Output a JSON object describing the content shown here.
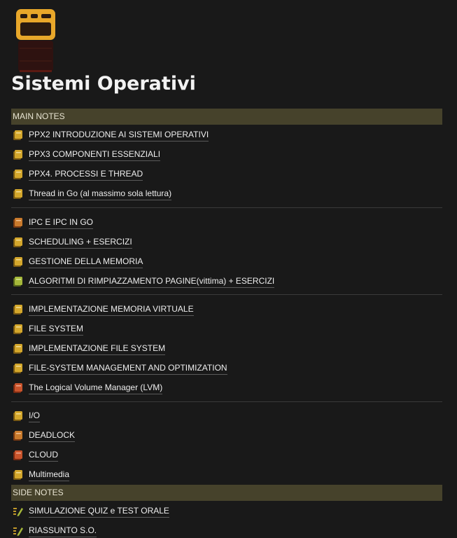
{
  "page": {
    "title": "Sistemi Operativi",
    "icon": "oven-icon"
  },
  "main_notes": {
    "header": "MAIN NOTES",
    "groups": [
      [
        {
          "label": "PPX2 INTRODUZIONE AI SISTEMI OPERATIVI",
          "icon": "notebook-icon",
          "color": "#d4a72c"
        },
        {
          "label": "PPX3 COMPONENTI ESSENZIALI",
          "icon": "notebook-icon",
          "color": "#d4a72c"
        },
        {
          "label": "PPX4. PROCESSI E THREAD",
          "icon": "notebook-icon",
          "color": "#d4a72c"
        },
        {
          "label": "Thread in Go (al massimo sola lettura)",
          "icon": "notebook-icon",
          "color": "#d4a72c"
        }
      ],
      [
        {
          "label": "IPC E IPC IN GO",
          "icon": "notebook-icon",
          "color": "#c97a2c"
        },
        {
          "label": "SCHEDULING + ESERCIZI",
          "icon": "notebook-icon",
          "color": "#d4a72c"
        },
        {
          "label": "GESTIONE DELLA MEMORIA",
          "icon": "notebook-icon",
          "color": "#d4a72c"
        },
        {
          "label": "ALGORITMI DI RIMPIAZZAMENTO PAGINE(vittima) + ESERCIZI",
          "icon": "notebook-icon",
          "color": "#a5b83a"
        }
      ],
      [
        {
          "label": "IMPLEMENTAZIONE MEMORIA VIRTUALE",
          "icon": "notebook-icon",
          "color": "#d4a72c"
        },
        {
          "label": "FILE SYSTEM",
          "icon": "notebook-icon",
          "color": "#d4a72c"
        },
        {
          "label": "IMPLEMENTAZIONE FILE SYSTEM",
          "icon": "notebook-icon",
          "color": "#d4a72c"
        },
        {
          "label": "FILE-SYSTEM MANAGEMENT AND OPTIMIZATION",
          "icon": "notebook-icon",
          "color": "#d4a72c"
        },
        {
          "label": "The Logical Volume Manager (LVM)",
          "icon": "notebook-icon",
          "color": "#c9542c"
        }
      ],
      [
        {
          "label": "I/O",
          "icon": "notebook-icon",
          "color": "#d4a72c"
        },
        {
          "label": "DEADLOCK",
          "icon": "notebook-icon",
          "color": "#c97a2c"
        },
        {
          "label": "CLOUD",
          "icon": "notebook-icon",
          "color": "#c9542c"
        },
        {
          "label": "Multimedia",
          "icon": "notebook-icon",
          "color": "#d4a72c"
        }
      ]
    ]
  },
  "side_notes": {
    "header": "SIDE NOTES",
    "items": [
      {
        "label": "SIMULAZIONE QUIZ e TEST ORALE",
        "icon": "checklist-pencil-icon"
      },
      {
        "label": "RIASSUNTO S.O.",
        "icon": "checklist-pencil-icon"
      }
    ]
  },
  "colors": {
    "background": "#191919",
    "section_header_bg": "#46422b",
    "text": "#eeeeee",
    "divider": "#3a3a3a"
  }
}
